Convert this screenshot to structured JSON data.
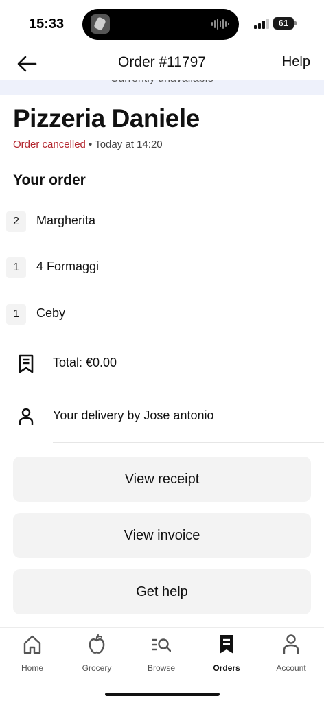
{
  "status_bar": {
    "time": "15:33",
    "battery": "61"
  },
  "header": {
    "title": "Order #11797",
    "help": "Help"
  },
  "unavailable_text": "Currently unavailable",
  "restaurant": {
    "name": "Pizzeria Daniele",
    "status": "Order cancelled",
    "separator": " • ",
    "time": "Today at 14:20"
  },
  "order": {
    "title": "Your order",
    "items": [
      {
        "qty": "2",
        "name": "Margherita"
      },
      {
        "qty": "1",
        "name": "4 Formaggi"
      },
      {
        "qty": "1",
        "name": "Ceby"
      }
    ],
    "total": "Total: €0.00",
    "delivery": "Your delivery by Jose antonio"
  },
  "actions": {
    "view_receipt": "View receipt",
    "view_invoice": "View invoice",
    "get_help": "Get help"
  },
  "nav": [
    {
      "label": "Home",
      "icon": "home-icon"
    },
    {
      "label": "Grocery",
      "icon": "apple-icon"
    },
    {
      "label": "Browse",
      "icon": "browse-icon"
    },
    {
      "label": "Orders",
      "icon": "receipt-icon",
      "active": true
    },
    {
      "label": "Account",
      "icon": "person-icon"
    }
  ],
  "colors": {
    "accent_cancelled": "#b3262e",
    "button_bg": "#f3f3f3",
    "banner_bg": "#eef1fb"
  }
}
